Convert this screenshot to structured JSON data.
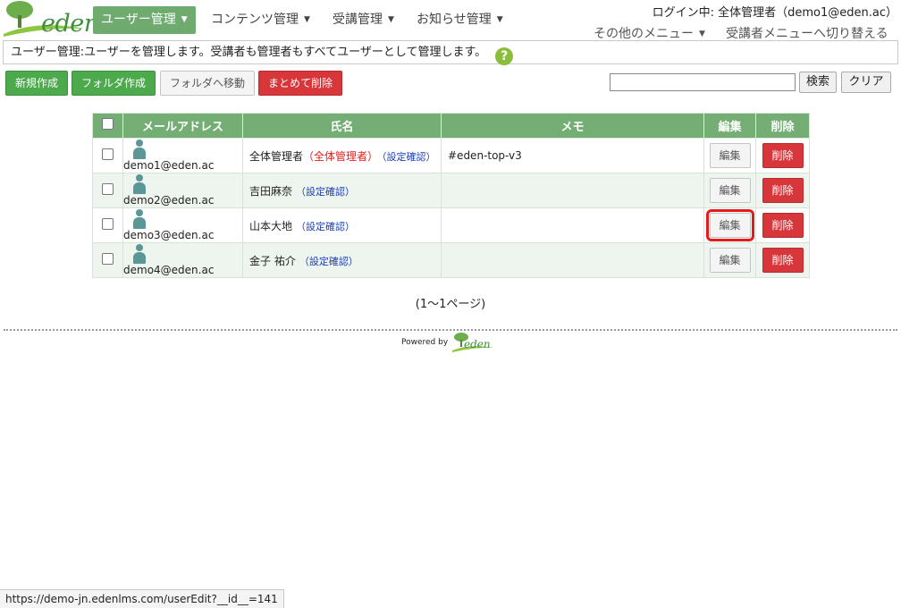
{
  "header": {
    "logo_text": "eden",
    "nav": [
      {
        "label": "ユーザー管理"
      },
      {
        "label": "コンテンツ管理"
      },
      {
        "label": "受講管理"
      },
      {
        "label": "お知らせ管理"
      }
    ],
    "login_info": "ログイン中: 全体管理者（demo1@eden.ac）",
    "other_menu": "その他のメニュー",
    "switch_menu": "受講者メニューへ切り替える"
  },
  "description": {
    "text": "ユーザー管理:ユーザーを管理します。受講者も管理者もすべてユーザーとして管理します。",
    "help_icon": "?"
  },
  "toolbar": {
    "new_label": "新規作成",
    "folder_create_label": "フォルダ作成",
    "move_folder_label": "フォルダへ移動",
    "bulk_delete_label": "まとめて削除",
    "search_value": "",
    "search_label": "検索",
    "clear_label": "クリア"
  },
  "table": {
    "headers": {
      "email": "メールアドレス",
      "name": "氏名",
      "memo": "メモ",
      "edit": "編集",
      "delete": "削除"
    },
    "rows": [
      {
        "email": "demo1@eden.ac",
        "name": "全体管理者",
        "role": "（全体管理者）",
        "confirm": "（設定確認）",
        "memo": "#eden-top-v3",
        "edit": "編集",
        "delete": "削除"
      },
      {
        "email": "demo2@eden.ac",
        "name": "吉田麻奈",
        "role": "",
        "confirm": "（設定確認）",
        "memo": "",
        "edit": "編集",
        "delete": "削除"
      },
      {
        "email": "demo3@eden.ac",
        "name": "山本大地",
        "role": "",
        "confirm": "（設定確認）",
        "memo": "",
        "edit": "編集",
        "delete": "削除"
      },
      {
        "email": "demo4@eden.ac",
        "name": "金子 祐介",
        "role": "",
        "confirm": "（設定確認）",
        "memo": "",
        "edit": "編集",
        "delete": "削除"
      }
    ]
  },
  "pager": "(1～1ページ)",
  "footer": {
    "powered_by": "Powered by",
    "logo_text": "eden"
  },
  "status_bar": "https://demo-jn.edenlms.com/userEdit?__id__=141",
  "colors": {
    "accent_green": "#74ae74",
    "danger_red": "#d7363b",
    "highlight_outline": "#e21b1b"
  }
}
